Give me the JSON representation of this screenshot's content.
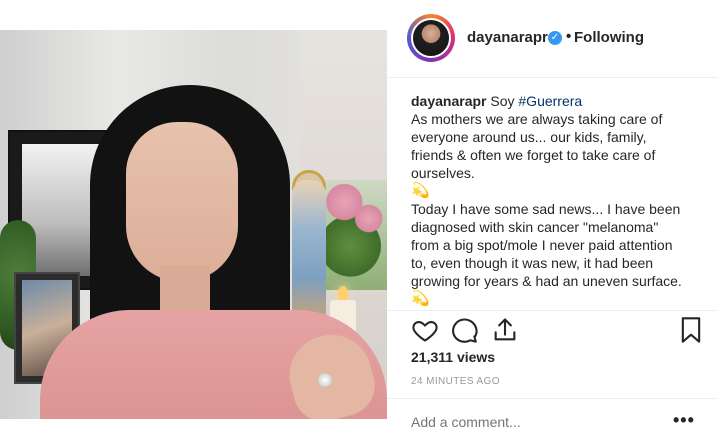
{
  "post": {
    "username": "dayanarapr",
    "verified": true,
    "follow_status": "Following",
    "caption": {
      "user": "dayanarapr",
      "first_line_text": "Soy ",
      "hashtag": "#Guerrera",
      "lines": [
        "As mothers we are always taking care of",
        "everyone around us... our kids, family,",
        "friends & often we forget to take care of",
        "ourselves.",
        "💫",
        "Today I have some sad news... I have been",
        "diagnosed with skin cancer \"melanoma\"",
        "from a big spot/mole I never paid attention",
        "to, even though it was new, it had been",
        "growing for years & had an uneven surface.",
        "💫"
      ]
    },
    "views": "21,311 views",
    "timestamp": "24 MINUTES AGO",
    "comment_placeholder": "Add a comment...",
    "more_label": "•••"
  },
  "icons": {
    "like": "heart-icon",
    "comment": "comment-icon",
    "share": "share-icon",
    "save": "bookmark-icon",
    "verified": "verified-badge-icon"
  },
  "colors": {
    "verified_blue": "#3897f0",
    "hashtag": "#003569",
    "muted": "#999999",
    "text": "#262626"
  }
}
